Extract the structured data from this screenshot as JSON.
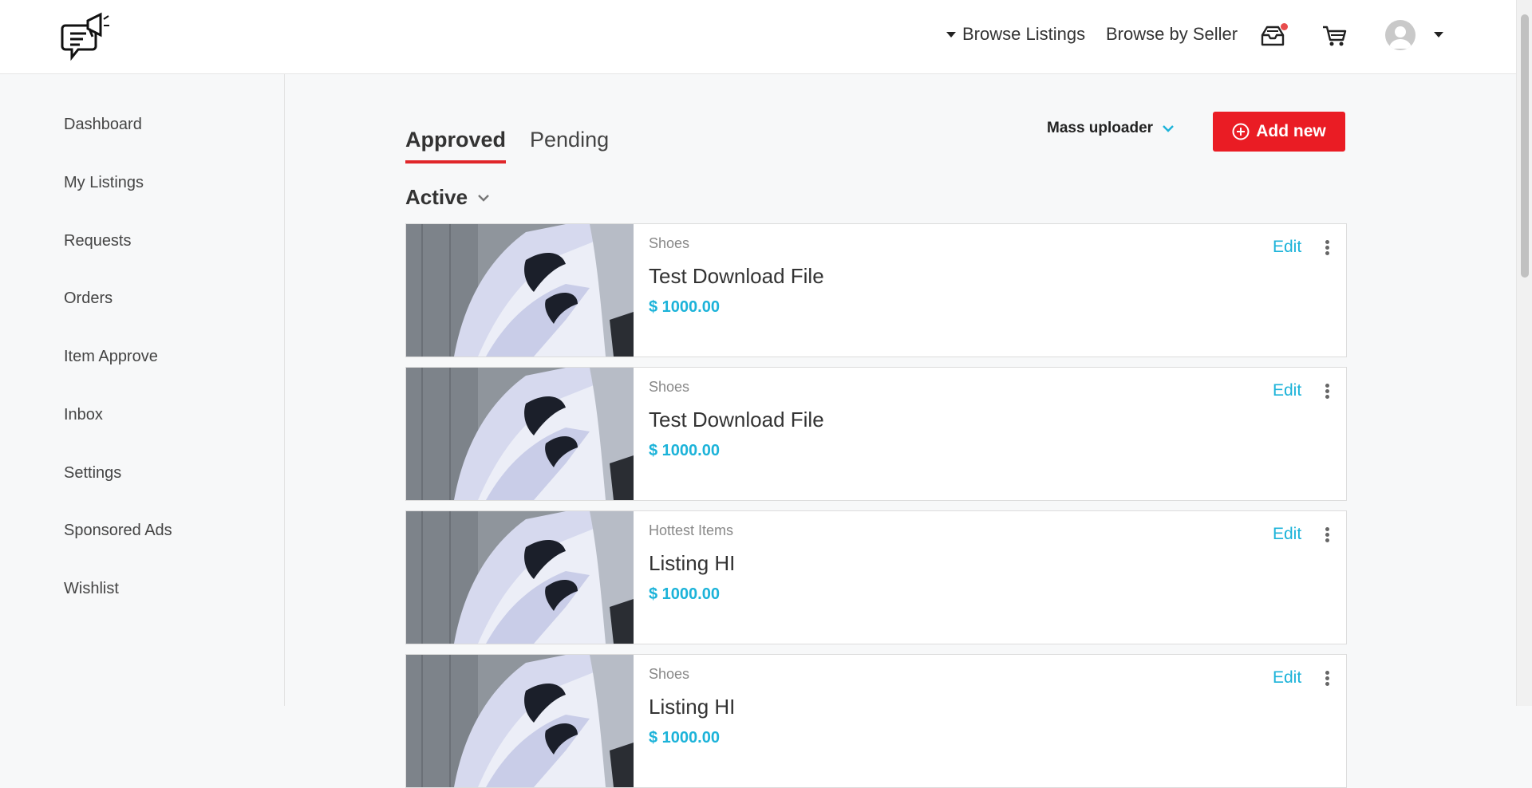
{
  "header": {
    "logo_icon": "megaphone-chat-logo",
    "browse_listings": "Browse Listings",
    "browse_by_seller": "Browse by Seller",
    "inbox_icon": "inbox-tray-icon",
    "cart_icon": "cart-icon",
    "avatar_icon": "user-avatar"
  },
  "sidebar": {
    "items": [
      {
        "label": "Dashboard"
      },
      {
        "label": "My Listings"
      },
      {
        "label": "Requests"
      },
      {
        "label": "Orders"
      },
      {
        "label": "Item Approve"
      },
      {
        "label": "Inbox"
      },
      {
        "label": "Settings"
      },
      {
        "label": "Sponsored Ads"
      },
      {
        "label": "Wishlist"
      }
    ]
  },
  "main": {
    "tabs": [
      {
        "label": "Approved",
        "active": true
      },
      {
        "label": "Pending",
        "active": false
      }
    ],
    "mass_uploader": "Mass uploader",
    "add_new": "Add new",
    "status_filter": "Active",
    "accent_color": "#ea1c24",
    "link_color": "#1cb3d9",
    "listings": [
      {
        "category": "Shoes",
        "title": "Test Download File",
        "price": "$ 1000.00",
        "edit": "Edit"
      },
      {
        "category": "Shoes",
        "title": "Test Download File",
        "price": "$ 1000.00",
        "edit": "Edit"
      },
      {
        "category": "Hottest Items",
        "title": "Listing HI",
        "price": "$ 1000.00",
        "edit": "Edit"
      },
      {
        "category": "Shoes",
        "title": "Listing HI",
        "price": "$ 1000.00",
        "edit": "Edit"
      }
    ]
  }
}
